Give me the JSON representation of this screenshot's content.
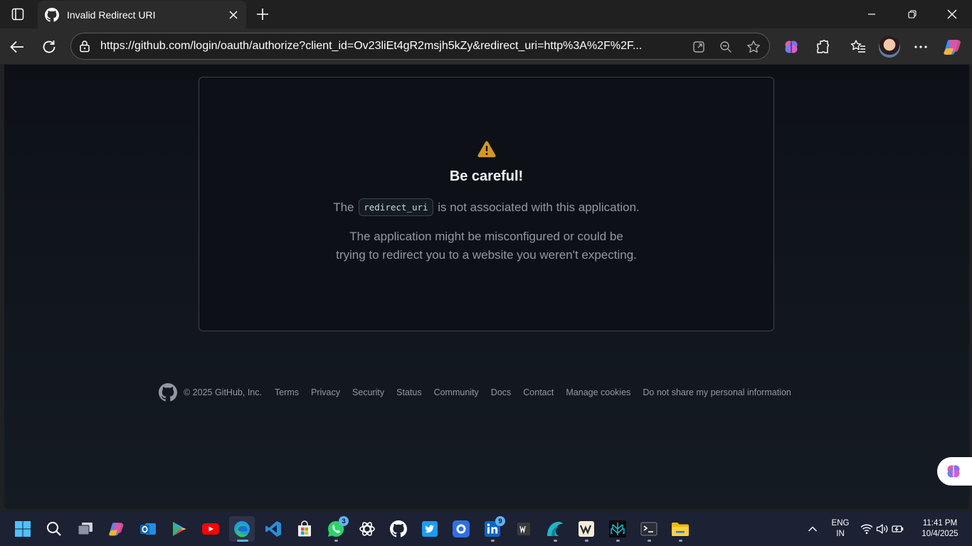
{
  "tab": {
    "title": "Invalid Redirect URI"
  },
  "address": {
    "url": "https://github.com/login/oauth/authorize?client_id=Ov23liEt4gR2msjh5kZy&redirect_uri=http%3A%2F%2F..."
  },
  "dialog": {
    "title": "Be careful!",
    "line1_pre": "The",
    "code": "redirect_uri",
    "line1_post": "is not associated with this application.",
    "line2a": "The application might be misconfigured or could be",
    "line2b": "trying to redirect you to a website you weren't expecting."
  },
  "footer": {
    "copyright": "© 2025 GitHub, Inc.",
    "links": [
      "Terms",
      "Privacy",
      "Security",
      "Status",
      "Community",
      "Docs",
      "Contact",
      "Manage cookies",
      "Do not share my personal information"
    ]
  },
  "taskbar": {
    "whatsapp_badge": "3",
    "linkedin_badge": "9",
    "lang_top": "ENG",
    "lang_bottom": "IN",
    "time": "11:41 PM",
    "date": "10/4/2025"
  },
  "colors": {
    "accent": "#d29922",
    "page_bg": "#0d1117",
    "border": "#3d444d",
    "muted_text": "#9198a1"
  }
}
